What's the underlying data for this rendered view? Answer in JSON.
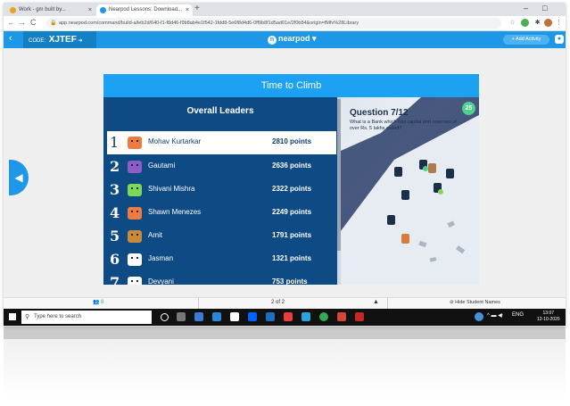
{
  "browser": {
    "tabs": [
      {
        "label": "Work - gm built by...",
        "active": false,
        "favicon_color": "#e8a317"
      },
      {
        "label": "Nearpod Lessons: Download...",
        "active": true,
        "favicon_color": "#1d97e6"
      }
    ],
    "new_tab_symbol": "+",
    "window_controls": [
      "–",
      "□"
    ],
    "nav": {
      "back": "←",
      "forward": "→",
      "reload": "C"
    },
    "url": "app.nearpod.com/command/build-a/leb2d/640-f1-f8d46-f9b8ab4e1f542-1fdd8-5e6f8d4d6-0ff9b8f1d5ad01e/2f0b84&origin=fMfv%28Library"
  },
  "nearpod_header": {
    "code_label": "CODE:",
    "code_value": "XJTEF",
    "logo_text": "nearpod",
    "add_activity_label": "+ Add Activity"
  },
  "panel": {
    "title": "Time to Climb",
    "leaders_heading": "Overall Leaders",
    "leaders": [
      {
        "rank": "1",
        "name": "Mohav Kurtarkar",
        "points": "2810 points",
        "avatar_color": "#f07b3f"
      },
      {
        "rank": "2",
        "name": "Gautami",
        "points": "2636 points",
        "avatar_color": "#8e5cc9"
      },
      {
        "rank": "3",
        "name": "Shivani Mishra",
        "points": "2322 points",
        "avatar_color": "#7ed957"
      },
      {
        "rank": "4",
        "name": "Shawn Menezes",
        "points": "2249 points",
        "avatar_color": "#f07b3f"
      },
      {
        "rank": "5",
        "name": "Amit",
        "points": "1791 points",
        "avatar_color": "#c98a3a"
      },
      {
        "rank": "6",
        "name": "Jasman",
        "points": "1321 points",
        "avatar_color": "#ffffff"
      },
      {
        "rank": "7",
        "name": "Devyani",
        "points": "753 points",
        "avatar_color": "#ffffff"
      }
    ],
    "question_title": "Question 7/12",
    "question_text": "What is a Bank which has capital and reserves of over Rs. 5 lakhs called?",
    "timer": "25"
  },
  "nearpod_footer": {
    "students_count": "8",
    "page_indicator": "2 of 2",
    "hide_names_label": "Hide Student Names"
  },
  "taskbar": {
    "search_placeholder": "Type here to search",
    "time": "13:07",
    "date": "12-10-2020",
    "lang": "ENG"
  },
  "colors": {
    "nearpod_blue": "#1d97e6",
    "panel_navy": "#0e4a84",
    "title_blue": "#1da1f2",
    "timer_green": "#4cd08a"
  }
}
